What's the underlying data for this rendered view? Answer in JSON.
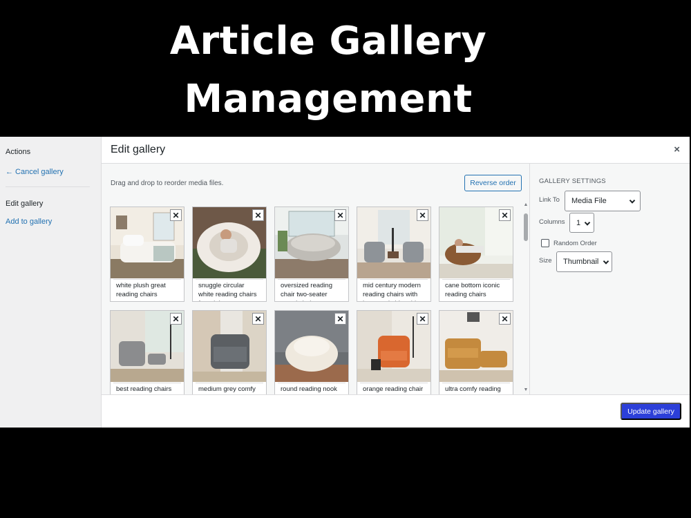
{
  "banner": {
    "title_line1": "Article Gallery",
    "title_line2": "Management"
  },
  "sidebar": {
    "actions_heading": "Actions",
    "cancel_link": "← Cancel gallery",
    "edit_heading": "Edit gallery",
    "add_link": "Add to gallery"
  },
  "dialog": {
    "title": "Edit gallery",
    "close_glyph": "×",
    "hint": "Drag and drop to reorder media files.",
    "reverse_label": "Reverse order",
    "update_label": "Update gallery"
  },
  "items": [
    {
      "caption": "white plush great reading chairs"
    },
    {
      "caption": "snuggle circular white reading chairs for adults"
    },
    {
      "caption": "oversized reading chair two-seater round chaise"
    },
    {
      "caption": "mid century modern reading chairs with lamp and side table"
    },
    {
      "caption": "cane bottom iconic reading chairs"
    },
    {
      "caption": "best reading chairs"
    },
    {
      "caption": "medium grey comfy"
    },
    {
      "caption": "round reading nook"
    },
    {
      "caption": "orange reading chair"
    },
    {
      "caption": "ultra comfy reading"
    }
  ],
  "settings": {
    "heading": "GALLERY SETTINGS",
    "link_to_label": "Link To",
    "link_to_value": "Media File",
    "columns_label": "Columns",
    "columns_value": "1",
    "random_label": "Random Order",
    "random_checked": false,
    "size_label": "Size",
    "size_value": "Thumbnail"
  },
  "colors": {
    "primary": "#2c3fd9",
    "link": "#2271b1"
  }
}
